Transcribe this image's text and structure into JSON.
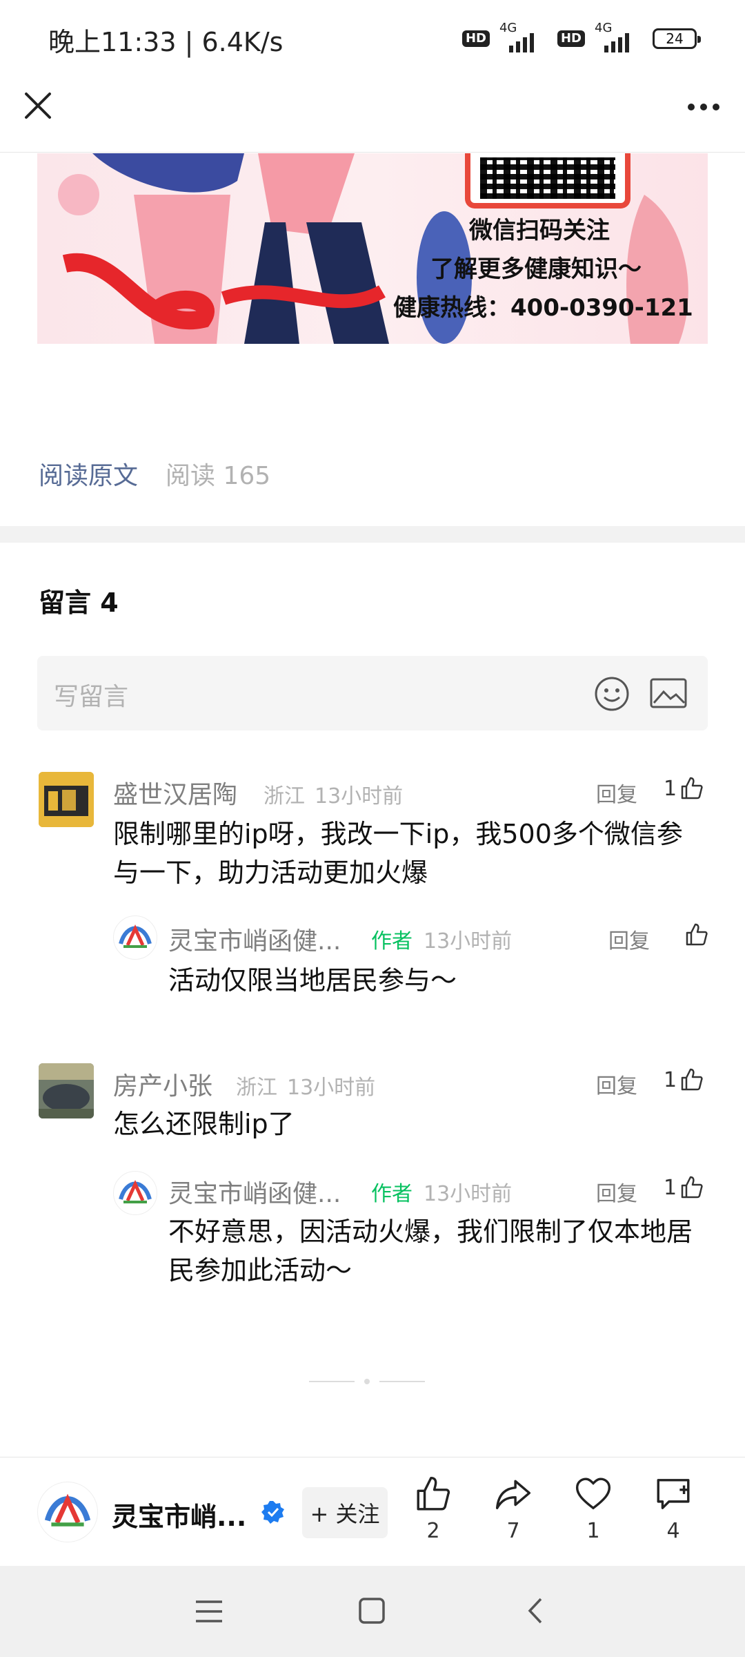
{
  "status_bar": {
    "time_speed": "晚上11:33 | 6.4K/s",
    "network1": "4G",
    "network2": "4G",
    "hd": "HD",
    "battery": "24"
  },
  "banner": {
    "line1": "微信扫码关注",
    "line2": "了解更多健康知识～",
    "line3": "健康热线：400-0390-121"
  },
  "article": {
    "read_original": "阅读原文",
    "read_count": "阅读 165"
  },
  "comments": {
    "title": "留言 4",
    "input_placeholder": "写留言",
    "reply_label": "回复",
    "author_tag": "作者",
    "items": [
      {
        "name": "盛世汉居陶",
        "location": "浙江",
        "time": "13小时前",
        "likes": "1",
        "text": "限制哪里的ip呀，我改一下ip，我500多个微信参与一下，助力活动更加火爆",
        "reply": {
          "name": "灵宝市峭函健...",
          "time": "13小时前",
          "likes": "",
          "text": "活动仅限当地居民参与～"
        }
      },
      {
        "name": "房产小张",
        "location": "浙江",
        "time": "13小时前",
        "likes": "1",
        "text": "怎么还限制ip了",
        "reply": {
          "name": "灵宝市峭函健...",
          "time": "13小时前",
          "likes": "1",
          "text": "不好意思，因活动火爆，我们限制了仅本地居民参加此活动～"
        }
      }
    ]
  },
  "bottom_bar": {
    "account_name": "灵宝市峭...",
    "follow_label": "+ 关注",
    "like_count": "2",
    "share_count": "7",
    "favorite_count": "1",
    "comment_count": "4"
  },
  "colors": {
    "link": "#576b95",
    "author": "#07c160",
    "verified": "#1d7cf0"
  }
}
